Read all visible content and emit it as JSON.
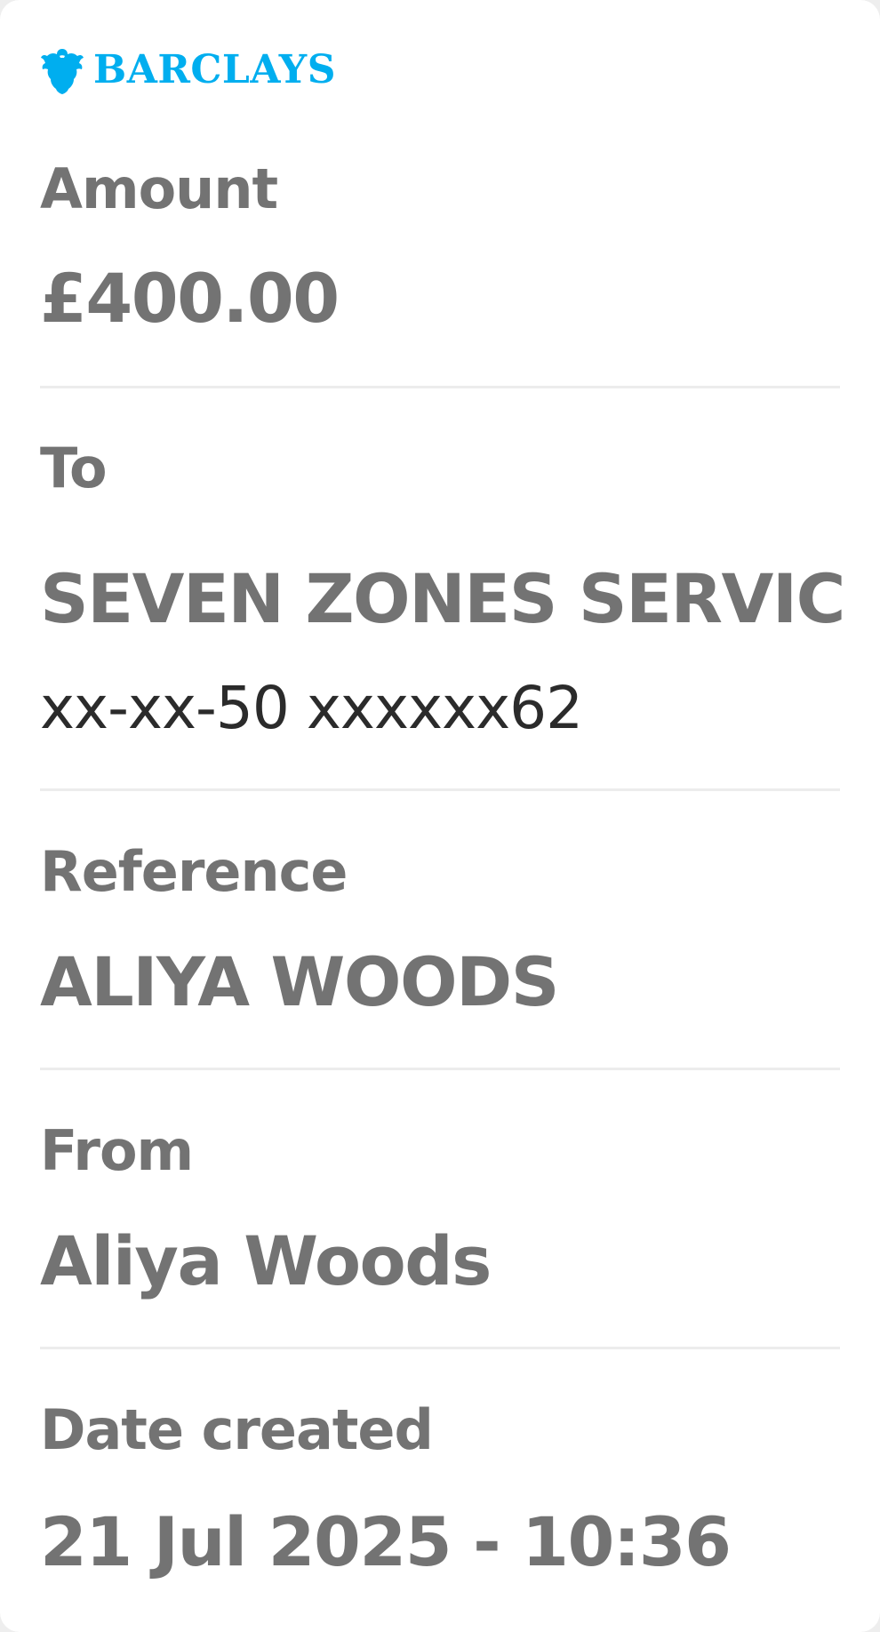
{
  "brand": {
    "name": "BARCLAYS",
    "icon": "eagle-icon",
    "color": "#00aeef"
  },
  "amount": {
    "label": "Amount",
    "value": "£400.00"
  },
  "to": {
    "label": "To",
    "name": "SEVEN ZONES SERVIC",
    "account": "xx-xx-50 xxxxxx62"
  },
  "reference": {
    "label": "Reference",
    "value": "ALIYA WOODS"
  },
  "from": {
    "label": "From",
    "value": "Aliya Woods"
  },
  "date_created": {
    "label": "Date created",
    "value": "21 Jul 2025 - 10:36"
  },
  "colors": {
    "text_grey": "#737373",
    "text_dark": "#2b2b2b",
    "divider": "#ececec",
    "card": "#ffffff"
  }
}
